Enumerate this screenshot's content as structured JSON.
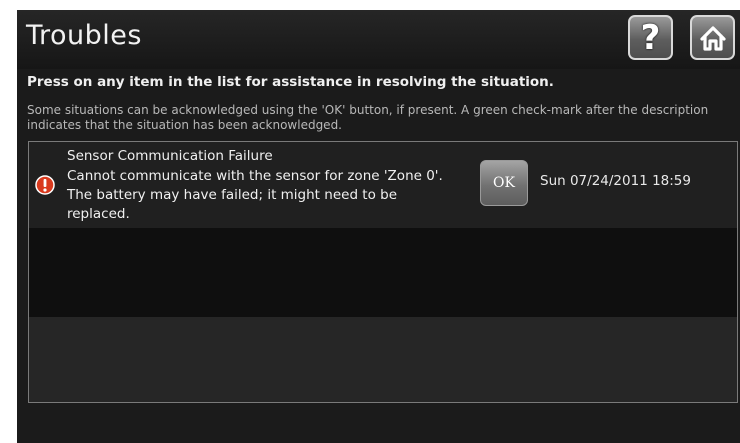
{
  "header": {
    "title": "Troubles",
    "help_icon": "question-mark-icon",
    "home_icon": "home-icon"
  },
  "instructions": {
    "primary": "Press on any item in the list for assistance in resolving the situation.",
    "secondary": "Some situations can be acknowledged using the 'OK' button, if present. A green check-mark after the description indicates that the situation has been acknowledged."
  },
  "troubles": [
    {
      "icon": "alert-icon",
      "title": "Sensor Communication Failure",
      "description": "Cannot communicate with the sensor for zone 'Zone 0'. The battery may have failed; it might need to be replaced.",
      "ok_label": "OK",
      "timestamp": "Sun 07/24/2011 18:59"
    }
  ],
  "colors": {
    "background": "#1b1b1b",
    "alert": "#d93a1e",
    "button": "#7a7a7a"
  }
}
